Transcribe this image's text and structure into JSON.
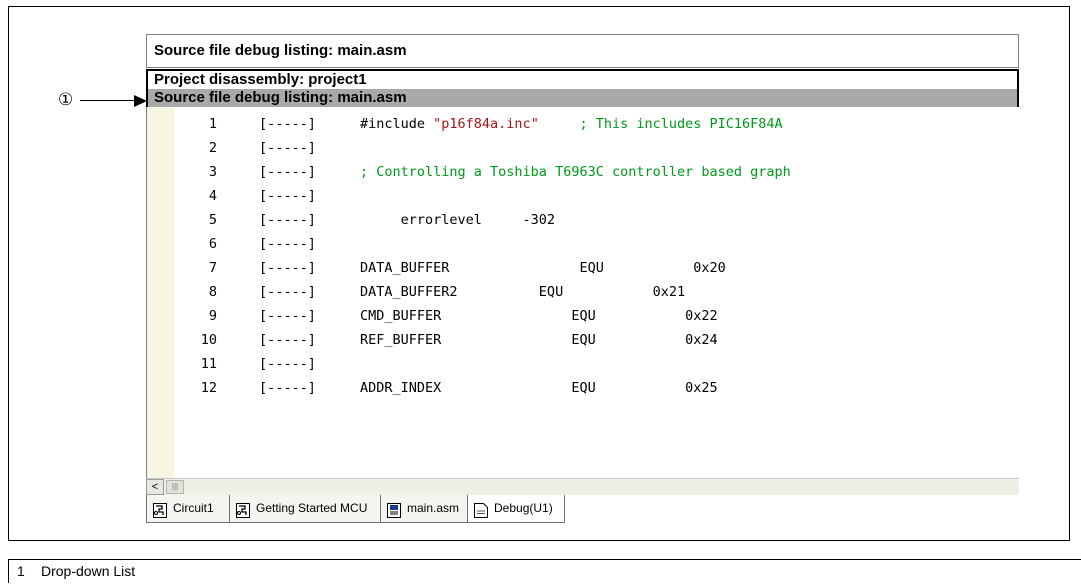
{
  "callout": {
    "marker": "①"
  },
  "dropdown": {
    "selected": "Source file debug listing: main.asm",
    "options": [
      {
        "label": "Project disassembly: project1"
      },
      {
        "label": "Source file debug listing: main.asm"
      }
    ]
  },
  "code_lines": [
    {
      "num": "1",
      "marker": "[-----]",
      "segments": [
        {
          "text": "#include ",
          "kind": "plain"
        },
        {
          "text": "\"p16f84a.inc\"",
          "kind": "str"
        },
        {
          "text": "     ; This includes PIC16F84A",
          "kind": "cmt"
        }
      ]
    },
    {
      "num": "2",
      "marker": "[-----]",
      "segments": []
    },
    {
      "num": "3",
      "marker": "[-----]",
      "segments": [
        {
          "text": "; Controlling a Toshiba T6963C controller based graph",
          "kind": "cmt"
        }
      ]
    },
    {
      "num": "4",
      "marker": "[-----]",
      "segments": []
    },
    {
      "num": "5",
      "marker": "[-----]",
      "segments": [
        {
          "text": "     errorlevel     -302",
          "kind": "plain"
        }
      ]
    },
    {
      "num": "6",
      "marker": "[-----]",
      "segments": []
    },
    {
      "num": "7",
      "marker": "[-----]",
      "segments": [
        {
          "text": "DATA_BUFFER                EQU           0x20",
          "kind": "plain"
        }
      ]
    },
    {
      "num": "8",
      "marker": "[-----]",
      "segments": [
        {
          "text": "DATA_BUFFER2          EQU           0x21",
          "kind": "plain"
        }
      ]
    },
    {
      "num": "9",
      "marker": "[-----]",
      "segments": [
        {
          "text": "CMD_BUFFER                EQU           0x22",
          "kind": "plain"
        }
      ]
    },
    {
      "num": "10",
      "marker": "[-----]",
      "segments": [
        {
          "text": "REF_BUFFER                EQU           0x24",
          "kind": "plain"
        }
      ]
    },
    {
      "num": "11",
      "marker": "[-----]",
      "segments": []
    },
    {
      "num": "12",
      "marker": "[-----]",
      "segments": [
        {
          "text": "ADDR_INDEX                EQU           0x25",
          "kind": "plain"
        }
      ]
    }
  ],
  "scrollbar": {
    "left_arrow": "<",
    "thumb_grip": "|||"
  },
  "tabs": [
    {
      "label": "Circuit1",
      "icon": "schematic-icon",
      "active": false
    },
    {
      "label": "Getting Started MCU",
      "icon": "schematic-icon",
      "active": false
    },
    {
      "label": "main.asm",
      "icon": "asm-file-icon",
      "active": false
    },
    {
      "label": "Debug(U1)",
      "icon": "document-icon",
      "active": true
    }
  ],
  "legend": {
    "num": "1",
    "text": "Drop-down List"
  }
}
